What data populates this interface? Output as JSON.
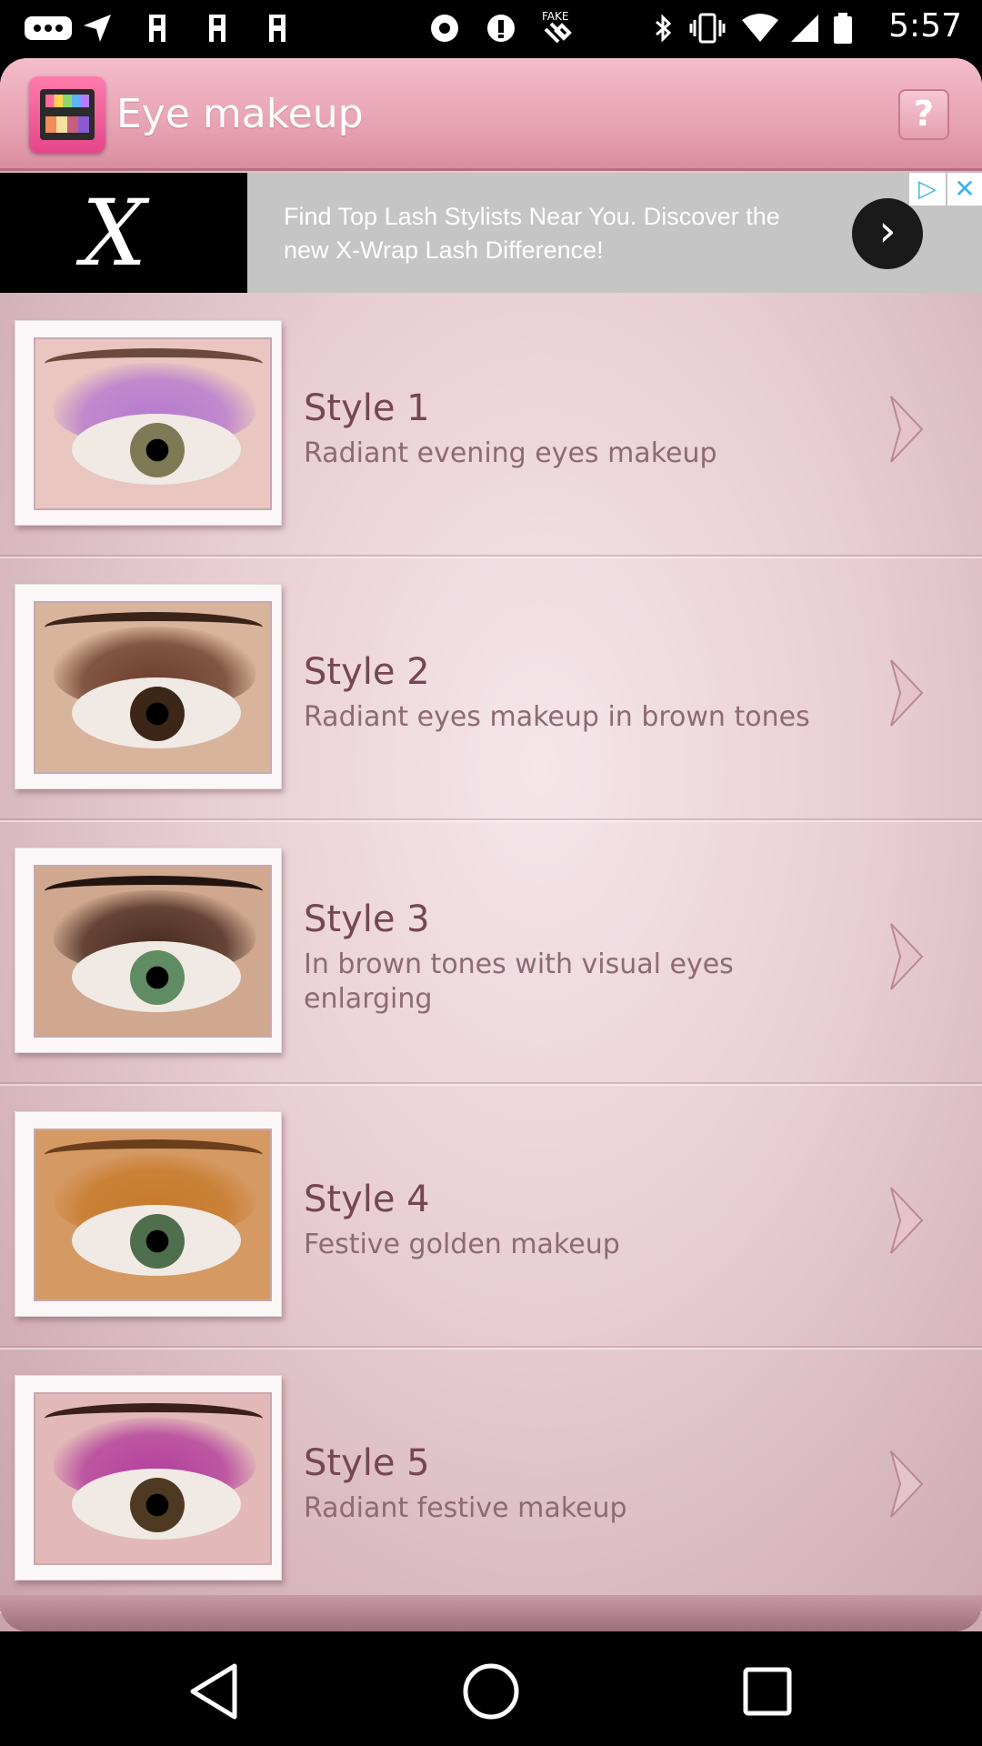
{
  "status_bar": {
    "time": "5:57",
    "icons": [
      "more-icon",
      "navigation-icon",
      "bookmark-icon",
      "bookmark-icon",
      "bookmark-icon",
      "record-icon",
      "info-icon",
      "fake-gps-icon",
      "bluetooth-icon",
      "vibrate-icon",
      "wifi-icon",
      "signal-icon",
      "battery-icon"
    ]
  },
  "header": {
    "title": "Eye makeup",
    "help_label": "?"
  },
  "ad": {
    "logo_text": "X",
    "text": "Find Top Lash Stylists Near You. Discover the new X-Wrap Lash Difference!",
    "arrow": "›",
    "choices": "▷",
    "close": "✕"
  },
  "styles": [
    {
      "title": "Style 1",
      "subtitle": "Radiant evening eyes makeup",
      "palette": {
        "lid": "#b67ad0",
        "brow": "#6b4a3e",
        "iris": "#7e7a56",
        "skin": "#e9c6c0"
      }
    },
    {
      "title": "Style 2",
      "subtitle": "Radiant eyes makeup in brown tones",
      "palette": {
        "lid": "#6b3f2c",
        "brow": "#3a2418",
        "iris": "#3b2618",
        "skin": "#d9b49c"
      }
    },
    {
      "title": "Style 3",
      "subtitle": "In brown tones with visual eyes enlarging",
      "palette": {
        "lid": "#4a2b20",
        "brow": "#241410",
        "iris": "#5f8c63",
        "skin": "#cfa88f"
      }
    },
    {
      "title": "Style 4",
      "subtitle": "Festive golden makeup",
      "palette": {
        "lid": "#c77a2c",
        "brow": "#6b3e1c",
        "iris": "#4f6e4e",
        "skin": "#d59a63"
      }
    },
    {
      "title": "Style 5",
      "subtitle": "Radiant festive makeup",
      "palette": {
        "lid": "#b43f9c",
        "brow": "#3a2018",
        "iris": "#4e3a22",
        "skin": "#e2b8b8"
      }
    }
  ],
  "nav": {
    "back": "back-icon",
    "home": "home-icon",
    "recents": "recents-icon"
  }
}
